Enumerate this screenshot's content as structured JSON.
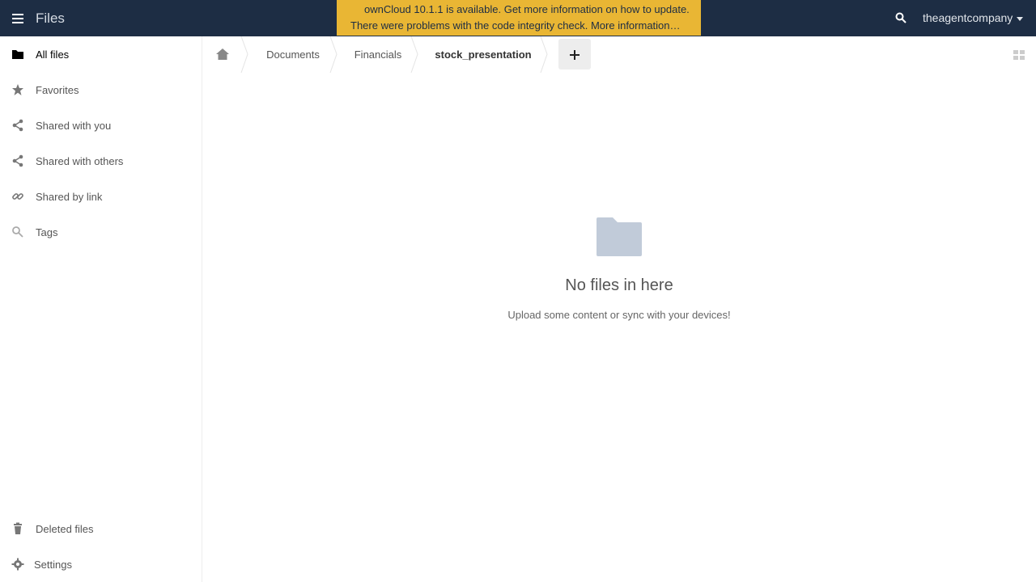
{
  "header": {
    "app_title": "Files",
    "notice_update": "ownCloud 10.1.1 is available. Get more information on how to update.",
    "notice_integrity": "There were problems with the code integrity check. More information…",
    "username": "theagentcompany",
    "colors": {
      "header_bg": "#1d2d44",
      "notice_bg": "#e9b634"
    }
  },
  "sidebar": {
    "items": [
      {
        "label": "All files",
        "icon": "folder-icon"
      },
      {
        "label": "Favorites",
        "icon": "star-icon"
      },
      {
        "label": "Shared with you",
        "icon": "share-icon"
      },
      {
        "label": "Shared with others",
        "icon": "share-icon"
      },
      {
        "label": "Shared by link",
        "icon": "link-icon"
      },
      {
        "label": "Tags",
        "icon": "tag-icon"
      }
    ],
    "bottom": [
      {
        "label": "Deleted files",
        "icon": "trash-icon"
      },
      {
        "label": "Settings",
        "icon": "gear-icon"
      }
    ]
  },
  "breadcrumb": {
    "home_icon": "home-icon",
    "items": [
      "Documents",
      "Financials",
      "stock_presentation"
    ]
  },
  "empty": {
    "title": "No files in here",
    "subtitle": "Upload some content or sync with your devices!"
  }
}
